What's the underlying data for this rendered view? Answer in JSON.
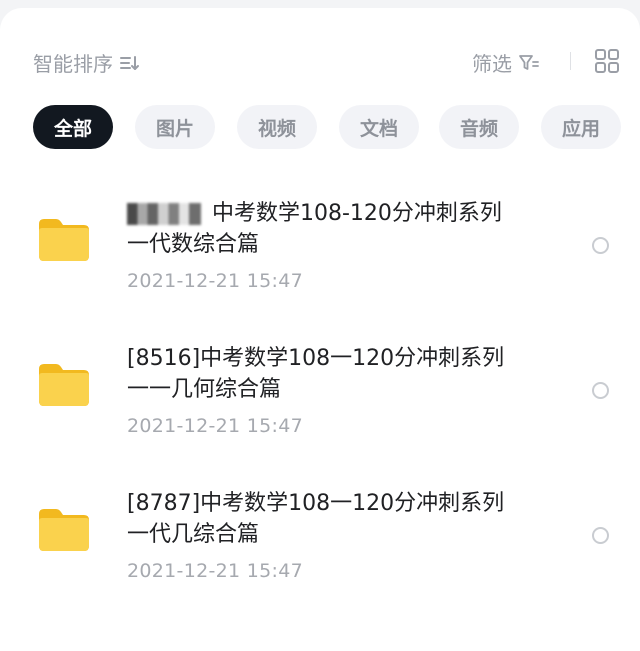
{
  "toolbar": {
    "sort_label": "智能排序",
    "sort_icon": "sort-icon",
    "filter_label": "筛选",
    "filter_icon": "filter-icon",
    "view_icon": "grid-view-icon"
  },
  "tabs": [
    {
      "label": "全部",
      "active": true
    },
    {
      "label": "图片",
      "active": false
    },
    {
      "label": "视频",
      "active": false
    },
    {
      "label": "文档",
      "active": false
    },
    {
      "label": "音频",
      "active": false
    },
    {
      "label": "应用",
      "active": false
    }
  ],
  "files": [
    {
      "title_line1": " 中考数学108-120分冲刺系列",
      "title_line2": "一代数综合篇",
      "date": "2021-12-21  15:47",
      "icon": "folder-icon",
      "redacted_prefix": true
    },
    {
      "title_line1": "[8516]中考数学108一120分冲刺系列",
      "title_line2": "一一几何综合篇",
      "date": "2021-12-21  15:47",
      "icon": "folder-icon",
      "redacted_prefix": false
    },
    {
      "title_line1": "[8787]中考数学108一120分冲刺系列",
      "title_line2": "一代几综合篇",
      "date": "2021-12-21  15:47",
      "icon": "folder-icon",
      "redacted_prefix": false
    }
  ],
  "colors": {
    "active_tab_bg": "#121820",
    "tab_bg": "#f2f3f7",
    "folder": "#f7c83a",
    "muted_text": "#9a9ea6"
  }
}
